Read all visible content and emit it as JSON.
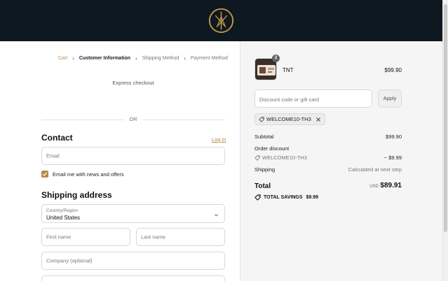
{
  "header": {
    "logo": "compass-logo"
  },
  "breadcrumb": {
    "items": [
      "Cart",
      "Customer Information",
      "Shipping Method",
      "Payment Method"
    ]
  },
  "express": {
    "label": "Express checkout"
  },
  "divider": {
    "label": "OR"
  },
  "contact": {
    "title": "Contact",
    "login_label": "Log in",
    "email_placeholder": "Email",
    "newsletter_label": "Email me with news and offers",
    "newsletter_checked": true
  },
  "shipping": {
    "title": "Shipping address",
    "country_label": "Country/Region",
    "country_value": "United States",
    "first_name_placeholder": "First name",
    "last_name_placeholder": "Last name",
    "company_placeholder": "Company (optional)"
  },
  "summary": {
    "item": {
      "name": "TNT",
      "price": "$99.90",
      "quantity": "2"
    },
    "discount_placeholder": "Discount code or gift card",
    "apply_label": "Apply",
    "applied_code": "WELCOME10-TH3",
    "subtotal_label": "Subtotal",
    "subtotal_value": "$99.90",
    "order_discount_label": "Order discount",
    "discount_code": "WELCOME10-TH3",
    "discount_value": "− $9.99",
    "shipping_label": "Shipping",
    "shipping_value": "Calculated at next step",
    "total_label": "Total",
    "currency": "USD",
    "total_value": "$89.91",
    "savings_label": "TOTAL SAVINGS",
    "savings_value": "$9.99"
  },
  "colors": {
    "header_bg": "#0e1820",
    "accent": "#b68b43",
    "summary_bg": "#f5f5f5"
  }
}
